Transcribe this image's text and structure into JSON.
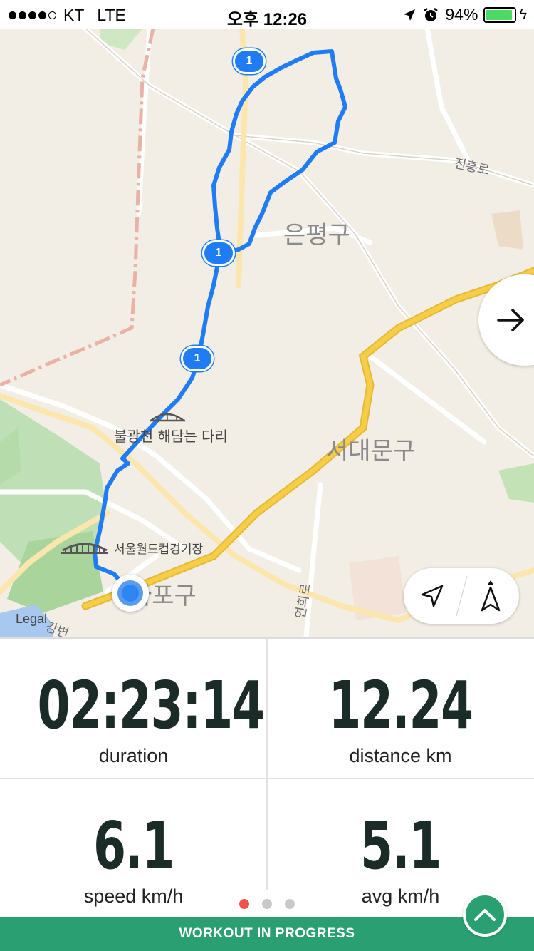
{
  "status_bar": {
    "carrier": "KT",
    "network": "LTE",
    "time": "오후 12:26",
    "battery_percent": "94%",
    "battery_level": 0.94
  },
  "map": {
    "labels": {
      "district_eunpyeong": "은평구",
      "district_seodaemun": "서대문구",
      "district_mapo": "마포구",
      "road_jinheung": "진흥로",
      "road_yeonhui": "연희로",
      "road_gangbyeon": "강변",
      "bridge": "불광천 해담는 다리",
      "stadium": "서울월드컵경기장"
    },
    "split_marker": "1",
    "legal": "Legal"
  },
  "stats": {
    "duration": {
      "value": "02:23:14",
      "label": "duration"
    },
    "distance": {
      "value": "12.24",
      "label": "distance km"
    },
    "speed": {
      "value": "6.1",
      "label": "speed km/h"
    },
    "avg_speed": {
      "value": "5.1",
      "label": "avg km/h"
    }
  },
  "pager": {
    "pages": 3,
    "active": 1
  },
  "bottom_bar": {
    "label": "WORKOUT IN PROGRESS"
  },
  "colors": {
    "route": "#1f7cf2",
    "accent": "#2aa072",
    "highway": "#f6cd46",
    "active_dot": "#f0534a"
  }
}
